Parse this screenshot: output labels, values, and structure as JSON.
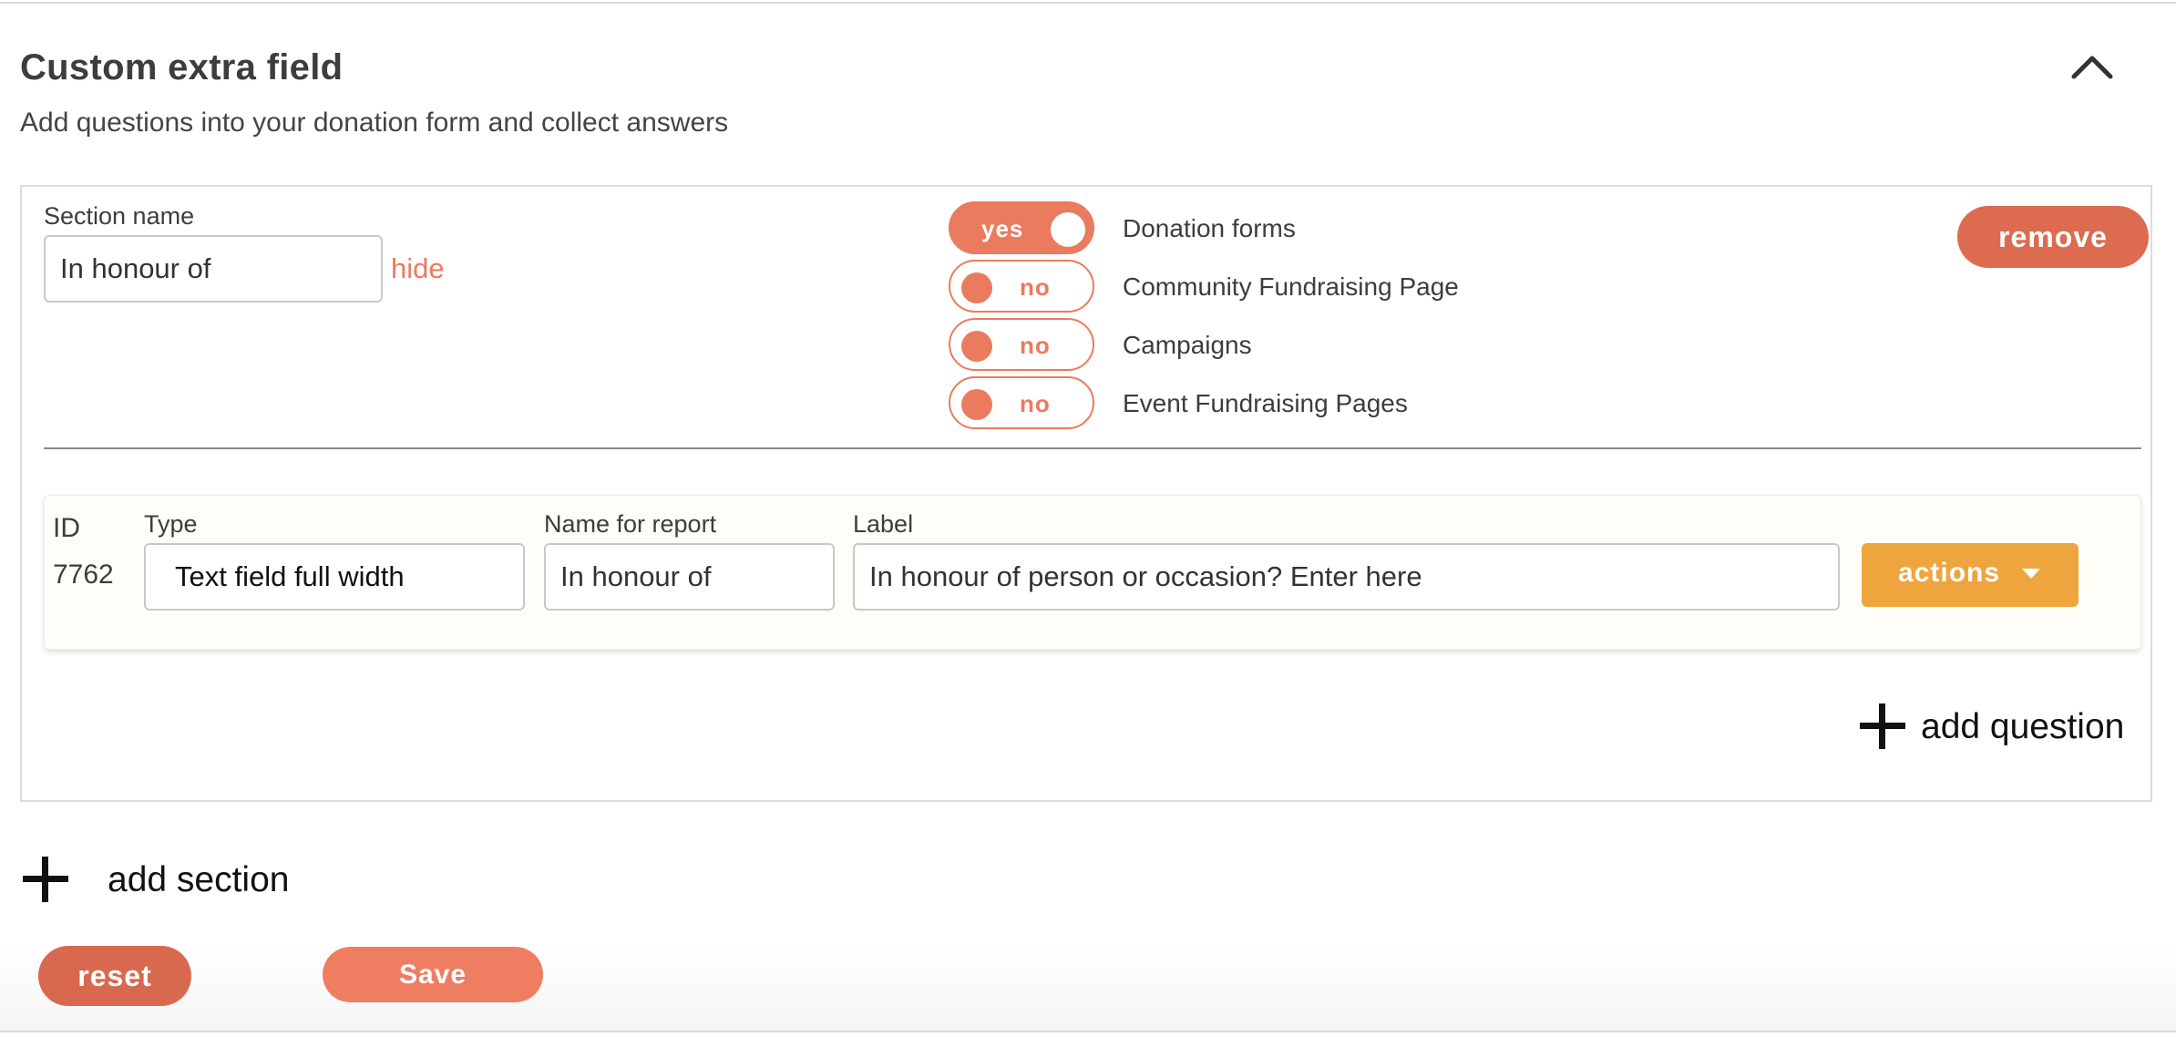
{
  "header": {
    "title": "Custom extra field",
    "subtitle": "Add questions into your donation form and collect answers",
    "collapse_icon": "chevron-up-icon"
  },
  "section": {
    "name_label": "Section name",
    "name_value": "In honour of",
    "hide_link": "hide",
    "remove_label": "remove",
    "toggles": [
      {
        "state": "yes",
        "on": true,
        "caption": "Donation forms"
      },
      {
        "state": "no",
        "on": false,
        "caption": "Community Fundraising Page"
      },
      {
        "state": "no",
        "on": false,
        "caption": "Campaigns"
      },
      {
        "state": "no",
        "on": false,
        "caption": "Event Fundraising Pages"
      }
    ]
  },
  "question": {
    "id_label": "ID",
    "id_value": "7762",
    "type_label": "Type",
    "type_value": "Text field full width",
    "report_label": "Name for report",
    "report_value": "In honour of",
    "label_label": "Label",
    "label_value": "In honour of person or occasion? Enter here",
    "actions_label": "actions",
    "actions_icon": "caret-down-icon"
  },
  "add_question_label": "add question",
  "add_section_label": "add section",
  "footer": {
    "reset_label": "reset",
    "save_label": "Save"
  },
  "colors": {
    "accent": "#ea7b5e",
    "remove": "#dd6b50",
    "actions": "#efa53d"
  }
}
